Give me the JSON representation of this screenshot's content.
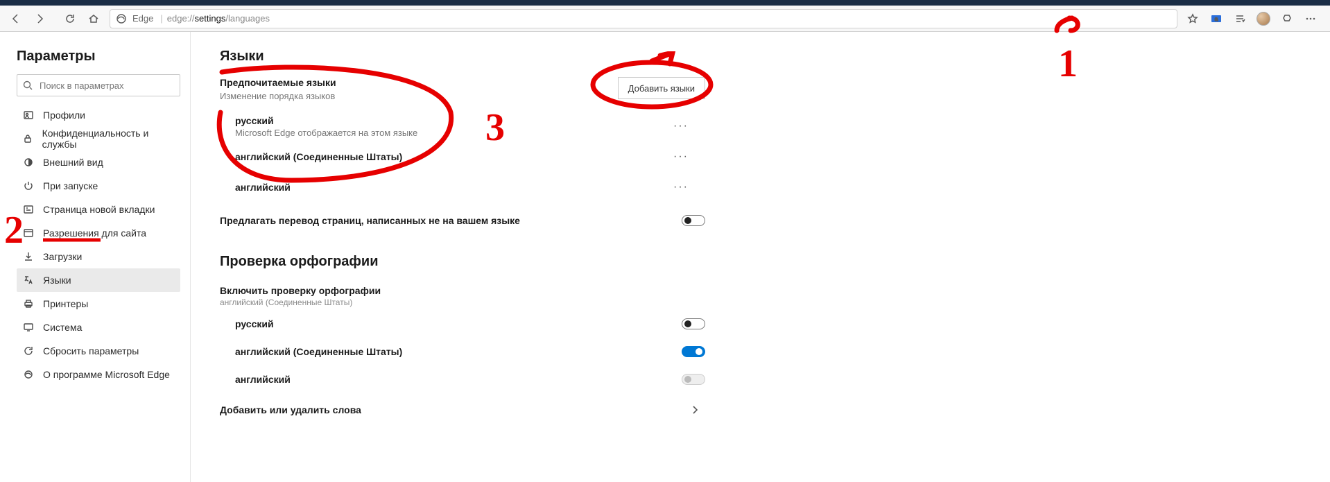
{
  "toolbar": {
    "site_label": "Edge",
    "url_prefix": "edge://",
    "url_mid": "settings",
    "url_suffix": "/languages"
  },
  "sidebar": {
    "heading": "Параметры",
    "search_placeholder": "Поиск в параметрах",
    "items": [
      {
        "label": "Профили"
      },
      {
        "label": "Конфиденциальность и службы"
      },
      {
        "label": "Внешний вид"
      },
      {
        "label": "При запуске"
      },
      {
        "label": "Страница новой вкладки"
      },
      {
        "label": "Разрешения для сайта"
      },
      {
        "label": "Загрузки"
      },
      {
        "label": "Языки"
      },
      {
        "label": "Принтеры"
      },
      {
        "label": "Система"
      },
      {
        "label": "Сбросить параметры"
      },
      {
        "label": "О программе Microsoft Edge"
      }
    ]
  },
  "languages": {
    "heading": "Языки",
    "preferred_title": "Предпочитаемые языки",
    "preferred_sub": "Изменение порядка языков",
    "add_button": "Добавить языки",
    "list": [
      {
        "name": "русский",
        "sub": "Microsoft Edge отображается на этом языке"
      },
      {
        "name": "английский (Соединенные Штаты)",
        "sub": ""
      },
      {
        "name": "английский",
        "sub": ""
      }
    ],
    "offer_translate": "Предлагать перевод страниц, написанных не на вашем языке"
  },
  "spellcheck": {
    "heading": "Проверка орфографии",
    "enable_title": "Включить проверку орфографии",
    "enable_sub": "английский (Соединенные Штаты)",
    "langs": [
      {
        "name": "русский",
        "state": "off"
      },
      {
        "name": "английский (Соединенные Штаты)",
        "state": "on"
      },
      {
        "name": "английский",
        "state": "disabled"
      }
    ],
    "add_remove_words": "Добавить или удалить слова"
  },
  "annotations": {
    "n1": "1",
    "n2": "2",
    "n3": "3"
  }
}
